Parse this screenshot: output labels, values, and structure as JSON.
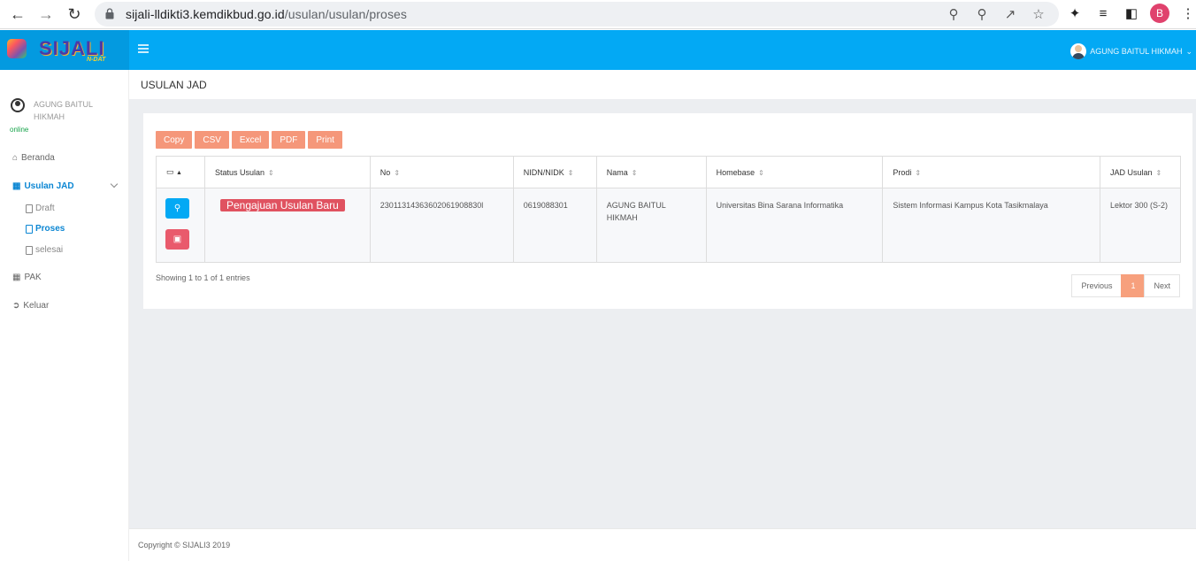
{
  "browser": {
    "url_host": "sijali-lldikti3.kemdikbud.go.id",
    "url_path": "/usulan/usulan/proses",
    "profile_initial": "B"
  },
  "header": {
    "logo_text": "SIJALI",
    "logo_sub": "N-DAT",
    "user_name": "AGUNG BAITUL HIKMAH"
  },
  "sidebar": {
    "user_name": "AGUNG BAITUL HIKMAH",
    "status": "online",
    "items": [
      {
        "label": "Beranda",
        "icon": "home-icon"
      },
      {
        "label": "Usulan JAD",
        "icon": "grid-icon"
      },
      {
        "label": "PAK",
        "icon": "grid-icon"
      },
      {
        "label": "Keluar",
        "icon": "logout-icon"
      }
    ],
    "subitems": [
      {
        "label": "Draft"
      },
      {
        "label": "Proses"
      },
      {
        "label": "selesai"
      }
    ]
  },
  "page": {
    "title": "USULAN JAD"
  },
  "toolbar": {
    "copy": "Copy",
    "csv": "CSV",
    "excel": "Excel",
    "pdf": "PDF",
    "print": "Print"
  },
  "table": {
    "columns": [
      "Status Usulan",
      "No",
      "NIDN/NIDK",
      "Nama",
      "Homebase",
      "Prodi",
      "JAD Usulan"
    ],
    "rows": [
      {
        "status": "Pengajuan Usulan Baru",
        "no": "23011314363602061908830l",
        "nidn": "0619088301",
        "nama": "AGUNG BAITUL HIKMAH",
        "homebase": "Universitas Bina Sarana Informatika",
        "prodi": "Sistem Informasi Kampus Kota Tasikmalaya",
        "jad": "Lektor 300 (S-2)"
      }
    ]
  },
  "info": "Showing 1 to 1 of 1 entries",
  "pagination": {
    "previous": "Previous",
    "current": "1",
    "next": "Next"
  },
  "footer": "Copyright © SIJALI3 2019",
  "colors": {
    "header": "#03a9f4",
    "button": "#f5977a",
    "badge": "#e05260"
  }
}
